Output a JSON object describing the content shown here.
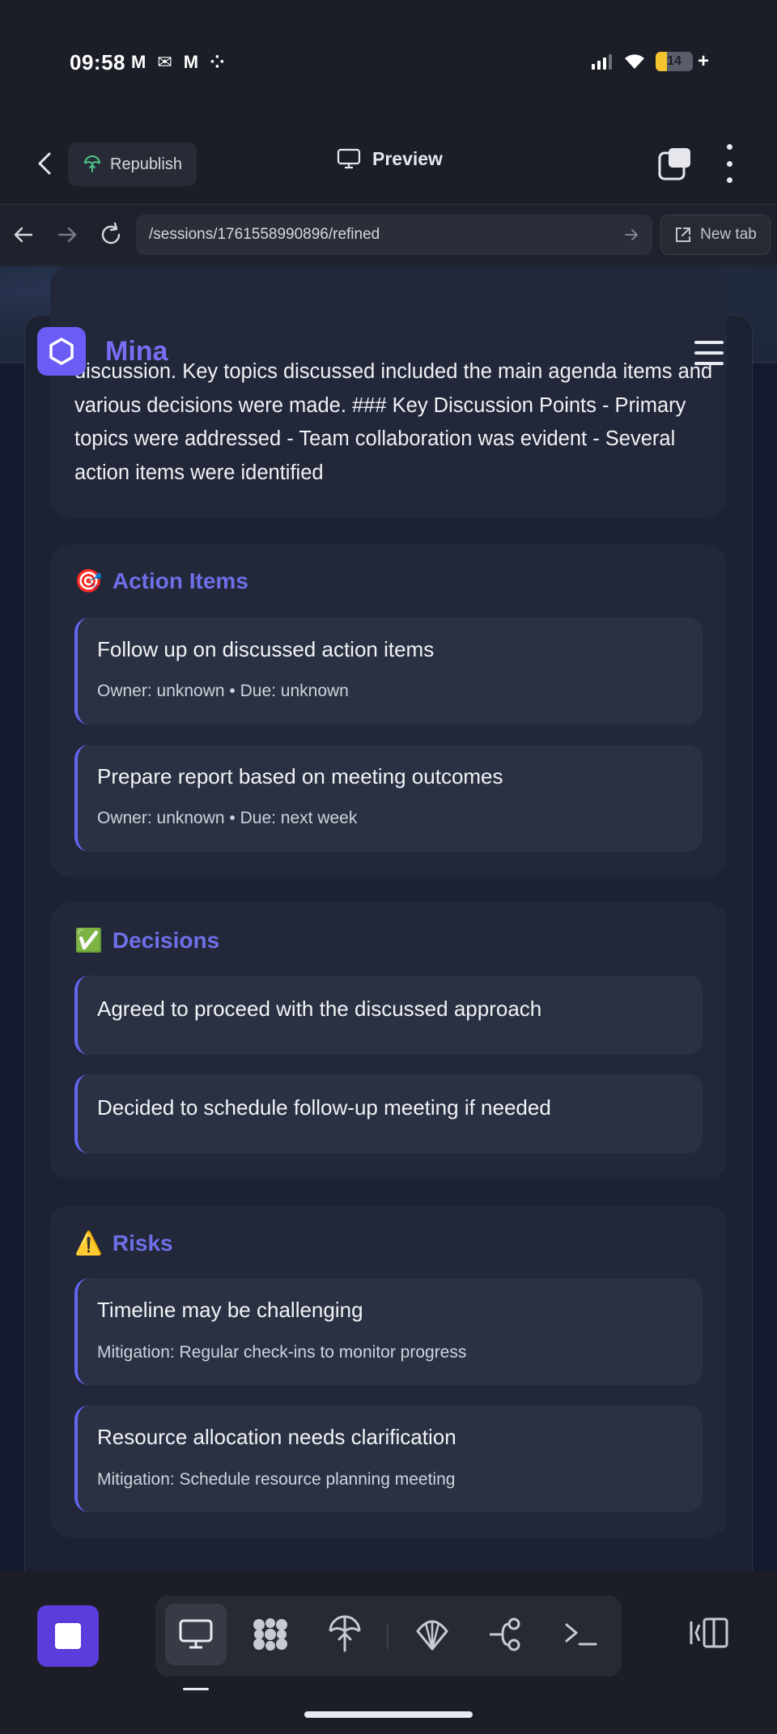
{
  "status_bar": {
    "time": "09:58",
    "notifications": [
      "M",
      "✉",
      "M",
      "⁘"
    ],
    "battery": "14",
    "battery_plus": "+"
  },
  "app_bar": {
    "republish_label": "Republish",
    "preview_label": "Preview"
  },
  "browser": {
    "url": "/sessions/1761558990896/refined",
    "new_tab_label": "New tab"
  },
  "page": {
    "brand": "Mina",
    "summary_text": "discussion. Key topics discussed included the main agenda items and various decisions were made. ### Key Discussion Points - Primary topics were addressed - Team collaboration was evident - Several action items were identified",
    "action_items": {
      "emoji": "🎯",
      "title": "Action Items",
      "items": [
        {
          "title": "Follow up on discussed action items",
          "meta": "Owner: unknown • Due: unknown"
        },
        {
          "title": "Prepare report based on meeting outcomes",
          "meta": "Owner: unknown • Due: next week"
        }
      ]
    },
    "decisions": {
      "emoji": "✅",
      "title": "Decisions",
      "items": [
        {
          "title": "Agreed to proceed with the discussed approach"
        },
        {
          "title": "Decided to schedule follow-up meeting if needed"
        }
      ]
    },
    "risks": {
      "emoji": "⚠️",
      "title": "Risks",
      "items": [
        {
          "title": "Timeline may be challenging",
          "meta": "Mitigation: Regular check-ins to monitor progress"
        },
        {
          "title": "Resource allocation needs clarification",
          "meta": "Mitigation: Schedule resource planning meeting"
        }
      ]
    }
  },
  "colors": {
    "accent": "#6366f1",
    "brand": "#7b6cf6",
    "stop_button": "#5b3ddb"
  },
  "icons": {
    "toolbar": [
      "monitor-icon",
      "grid-blob-icon",
      "umbrella-upload-icon",
      "shell-icon",
      "branch-icon",
      "terminal-icon"
    ]
  }
}
